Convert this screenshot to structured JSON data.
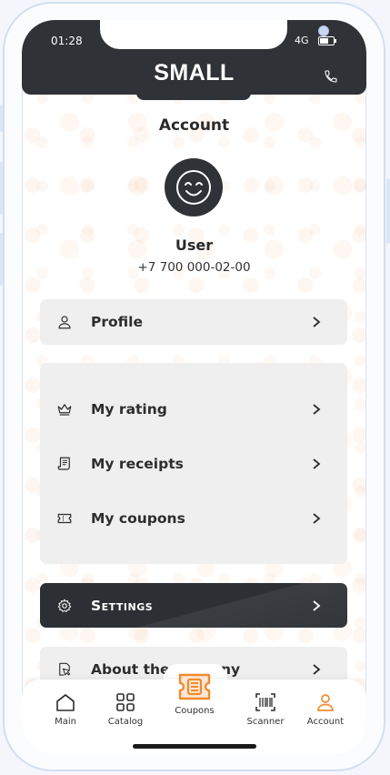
{
  "status": {
    "time": "01:28",
    "network": "4G"
  },
  "header": {
    "brand": "SMALL"
  },
  "page": {
    "title": "Account"
  },
  "user": {
    "name": "User",
    "phone": "+7 700 000-02-00"
  },
  "menu": {
    "profile": {
      "label": "Profile",
      "icon": "person-icon"
    },
    "group": [
      {
        "label": "My rating",
        "icon": "crown-icon"
      },
      {
        "label": "My receipts",
        "icon": "receipt-icon"
      },
      {
        "label": "My coupons",
        "icon": "coupon-icon"
      }
    ],
    "settings": {
      "label": "Settings",
      "icon": "gear-icon"
    },
    "about": {
      "label_left": "About the",
      "label_right": "ny",
      "icon": "hand-icon"
    }
  },
  "tabbar": {
    "items": [
      {
        "label": "Main",
        "icon": "home-icon"
      },
      {
        "label": "Catalog",
        "icon": "grid-icon"
      },
      {
        "label": "Coupons",
        "icon": "coupon-icon"
      },
      {
        "label": "Scanner",
        "icon": "barcode-icon"
      },
      {
        "label": "Account",
        "icon": "person-icon"
      }
    ],
    "active": "Account"
  },
  "colors": {
    "accent": "#f28a2e",
    "dark": "#2f3236",
    "card": "#efefef"
  }
}
